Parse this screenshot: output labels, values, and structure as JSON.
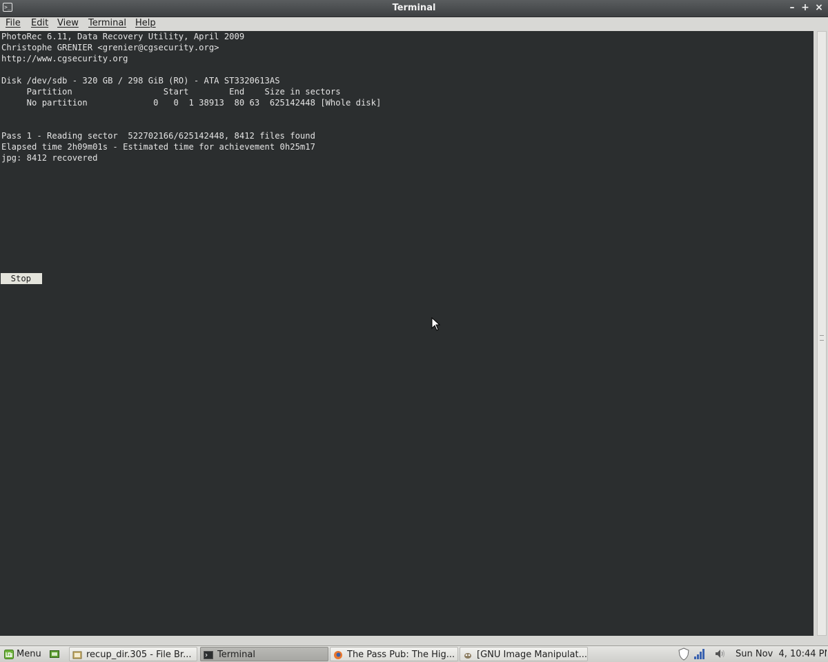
{
  "window": {
    "title": "Terminal"
  },
  "menubar": {
    "items": [
      "File",
      "Edit",
      "View",
      "Terminal",
      "Help"
    ]
  },
  "terminal": {
    "lines": [
      "PhotoRec 6.11, Data Recovery Utility, April 2009",
      "Christophe GRENIER <grenier@cgsecurity.org>",
      "http://www.cgsecurity.org",
      "",
      "Disk /dev/sdb - 320 GB / 298 GiB (RO) - ATA ST3320613AS",
      "     Partition                  Start        End    Size in sectors",
      "     No partition             0   0  1 38913  80 63  625142448 [Whole disk]",
      "",
      "",
      "Pass 1 - Reading sector  522702166/625142448, 8412 files found",
      "Elapsed time 2h09m01s - Estimated time for achievement 0h25m17",
      "jpg: 8412 recovered"
    ],
    "stop_button": "  Stop"
  },
  "taskbar": {
    "menu_label": "Menu",
    "tasks": [
      {
        "label": "recup_dir.305 - File Br..."
      },
      {
        "label": "Terminal"
      },
      {
        "label": "The Pass Pub: The Hig..."
      },
      {
        "label": "[GNU Image Manipulat..."
      }
    ],
    "clock": "Sun Nov  4, 10:44 PM"
  },
  "colors": {
    "terminal_bg": "#2b2e2f",
    "terminal_fg": "#e4e4e4",
    "mint_green": "#6fb33b"
  }
}
